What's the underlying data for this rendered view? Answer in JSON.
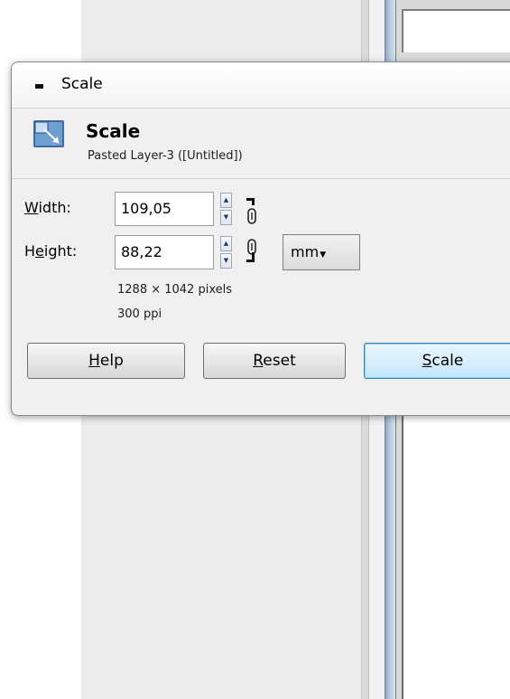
{
  "dialog": {
    "window_title": "Scale",
    "header_title": "Scale",
    "header_subtitle": "Pasted Layer-3 ([Untitled])",
    "width_label": "Width:",
    "width_value": "109,05",
    "height_label": "Height:",
    "height_value": "88,22",
    "unit": "mm",
    "pixel_info": "1288 × 1042 pixels",
    "resolution_info": "300 ppi",
    "help_button": "Help",
    "reset_button": "Reset",
    "scale_button": "Scale"
  },
  "icons": {
    "window_menu": "window-menu-icon",
    "scale_tool": "scale-tool-icon",
    "chain": "chain-link-icon",
    "spin": "spin-arrows-icon",
    "dropdown": "dropdown-arrow-icon"
  },
  "colors": {
    "dialog_bg": "#f0f0f0",
    "default_button": "#bee6fd",
    "canvas_blue": "#8fa8c8"
  }
}
